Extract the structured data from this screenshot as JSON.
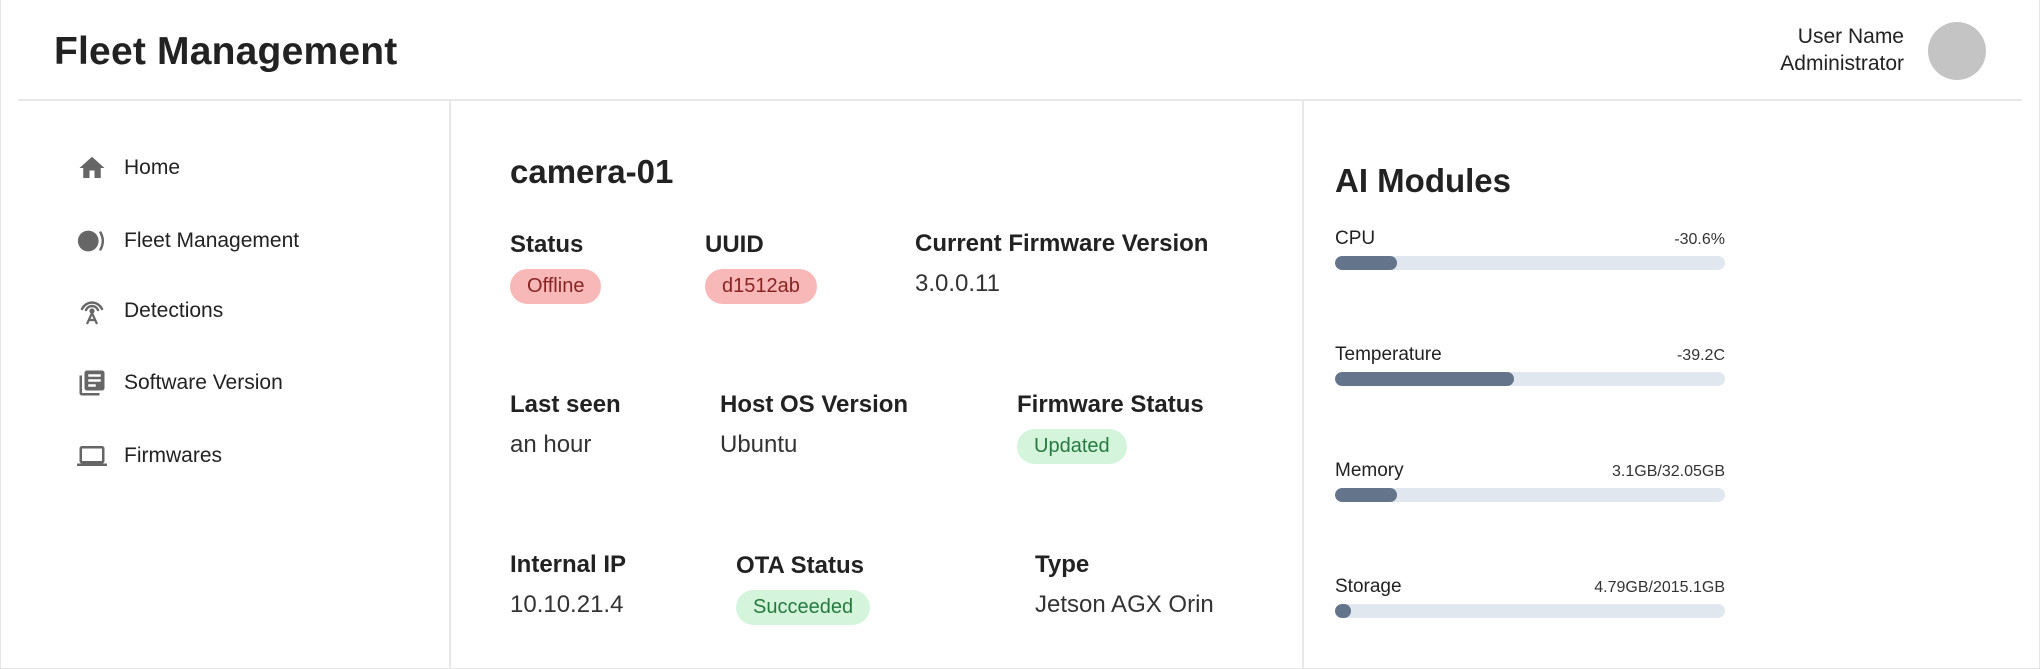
{
  "header": {
    "title": "Fleet Management",
    "user_name": "User Name",
    "user_role": "Administrator"
  },
  "sidebar": {
    "items": [
      {
        "label": "Home",
        "icon": "home-icon"
      },
      {
        "label": "Fleet Management",
        "icon": "fleet-icon"
      },
      {
        "label": "Detections",
        "icon": "antenna-icon"
      },
      {
        "label": "Software Version",
        "icon": "library-icon"
      },
      {
        "label": "Firmwares",
        "icon": "laptop-icon"
      }
    ]
  },
  "device": {
    "name": "camera-01",
    "status": {
      "label": "Status",
      "value": "Offline"
    },
    "uuid": {
      "label": "UUID",
      "value": "d1512ab"
    },
    "firmware_version": {
      "label": "Current Firmware Version",
      "value": "3.0.0.11"
    },
    "last_seen": {
      "label": "Last seen",
      "value": "an hour"
    },
    "host_os": {
      "label": "Host OS Version",
      "value": "Ubuntu"
    },
    "firmware_status": {
      "label": "Firmware Status",
      "value": "Updated"
    },
    "internal_ip": {
      "label": "Internal IP",
      "value": "10.10.21.4"
    },
    "ota_status": {
      "label": "OTA Status",
      "value": "Succeeded"
    },
    "type": {
      "label": "Type",
      "value": "Jetson AGX Orin"
    }
  },
  "modules": {
    "title": "AI Modules",
    "metrics": [
      {
        "label": "CPU",
        "value": "-30.6%",
        "level": 0.16
      },
      {
        "label": "Temperature",
        "value": "-39.2C",
        "level": 0.46
      },
      {
        "label": "Memory",
        "value": "3.1GB/32.05GB",
        "level": 0.16
      },
      {
        "label": "Storage",
        "value": "4.79GB/2015.1GB",
        "level": 0.04
      }
    ]
  },
  "colors": {
    "accent_bar": "#64748b",
    "track": "#e1e7ef",
    "badge_red_bg": "#f8b8b8",
    "badge_green_bg": "#d4f5dc"
  }
}
